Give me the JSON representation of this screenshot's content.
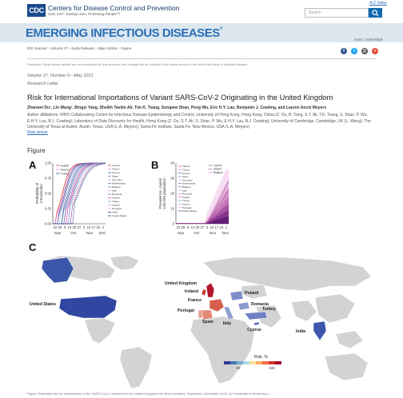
{
  "header": {
    "logo_text": "CDC",
    "agency_name": "Centers for Disease Control and Prevention",
    "tagline": "CDC 24/7: Saving Lives, Protecting People™",
    "az_index": "A-Z Index",
    "search_placeholder": "Search"
  },
  "banner": {
    "title": "EMERGING INFECTIOUS DISEASES",
    "reg_mark": "®"
  },
  "breadcrumb": [
    "EID Journal",
    "Volume 27",
    "Early Release",
    "Main Article",
    "Figure"
  ],
  "issn": "ISSN: 1080-6059",
  "social": [
    {
      "icon": "facebook-icon",
      "glyph": "f",
      "color": "#3b5998"
    },
    {
      "icon": "twitter-icon",
      "glyph": "t",
      "color": "#1da1f2"
    },
    {
      "icon": "email-icon",
      "glyph": "@",
      "color": "#555555"
    },
    {
      "icon": "share-icon",
      "glyph": "+",
      "color": "#e0533b"
    }
  ],
  "disclaimer": "Disclaimer: Early release articles are not considered as final versions. Any changes will be reflected in the online version in the month the article is officially released.",
  "article": {
    "volume": "Volume 27, Number 5—May 2021",
    "section": "Research Letter",
    "title": "Risk for International Importations of Variant SARS-CoV-2 Originating in the United Kingdom",
    "authors": "Zhanwei Du¹, Lin Wang¹, Bingyi Yang, Sheikh Taslim Ali, Tim K. Tsang, Songwei Shan, Peng Wu, Eric H.Y. Lau, Benjamin J. Cowling, and Lauren Ancel Meyers",
    "affiliations": "Author affiliations: WHO Collaborating Centre for Infectious Disease Epidemiology and Control, University of Hong Kong, Hong Kong, China (Z. Du, B. Yang, S.T. Ali, T.K. Tsang, S. Shan, P. Wu, E.H.Y. Lau, B.J. Cowling); Laboratory of Data Discovery for Health, Hong Kong (Z. Du, S.T. Ali, S. Shan, P. Wu, E.H.Y. Lau, B.J. Cowling); University of Cambridge, Cambridge, UK (L. Wang); The University of Texas at Austin, Austin, Texas, USA (L.A. Meyers); Santa Fe Institute, Santa Fe, New Mexico, USA (L.A. Meyers)",
    "main_link": "Main Article",
    "figure_label": "Figure"
  },
  "figure": {
    "panel_a": {
      "letter": "A",
      "ylabel": "Probability of introduction",
      "yticks": [
        "0.00",
        "0.25",
        "0.50",
        "0.75",
        "1.00"
      ],
      "xticks": [
        "22",
        "29",
        "6",
        "13",
        "20",
        "27",
        "3",
        "10",
        "17",
        "24",
        "1"
      ],
      "months": [
        "Sep",
        "Oct",
        "Nov",
        "Dec"
      ],
      "legend_left": [
        "Ireland",
        "Greece",
        "Turkey"
      ],
      "legend_right": [
        "Ireland",
        "France",
        "Greece",
        "Spain",
        "Germany",
        "Netherlands",
        "Belgium",
        "Italy",
        "Romania",
        "Poland",
        "Turkey",
        "Cyprus",
        "Portugal",
        "India",
        "United States"
      ]
    },
    "panel_b": {
      "letter": "B",
      "ylabel": "Prevalence, cases/ 100,000 population",
      "yticks": [
        "0",
        "10",
        "20",
        "30",
        "40"
      ],
      "xticks": [
        "22",
        "29",
        "6",
        "13",
        "20",
        "27",
        "3",
        "10",
        "17",
        "24",
        "1"
      ],
      "months": [
        "Sep",
        "Oct",
        "Nov",
        "Dec"
      ],
      "legend_left": [
        "Ireland",
        "France",
        "Greece",
        "Spain",
        "Germany",
        "Netherlands",
        "Belgium",
        "Italy",
        "Romania",
        "Poland",
        "Turkey",
        "Cyprus",
        "Portugal",
        "United States"
      ],
      "legend_right": [
        "Cyprus",
        "Ireland",
        "Belgium"
      ]
    },
    "panel_c": {
      "letter": "C",
      "countries": [
        "United Kingdom",
        "Ireland",
        "France",
        "Portugal",
        "Spain",
        "Italy",
        "Poland",
        "Romania",
        "Turkey",
        "Cyprus",
        "India",
        "United States"
      ],
      "legend_title": "Risk, %",
      "legend_ticks": [
        "50",
        "100"
      ]
    }
  },
  "caption_strip": "Figure. Estimated risk for introductions of the SARS-CoV-2 variant from the United Kingdom into other countries, September–December 2020. A) Probability of introduction ..."
}
